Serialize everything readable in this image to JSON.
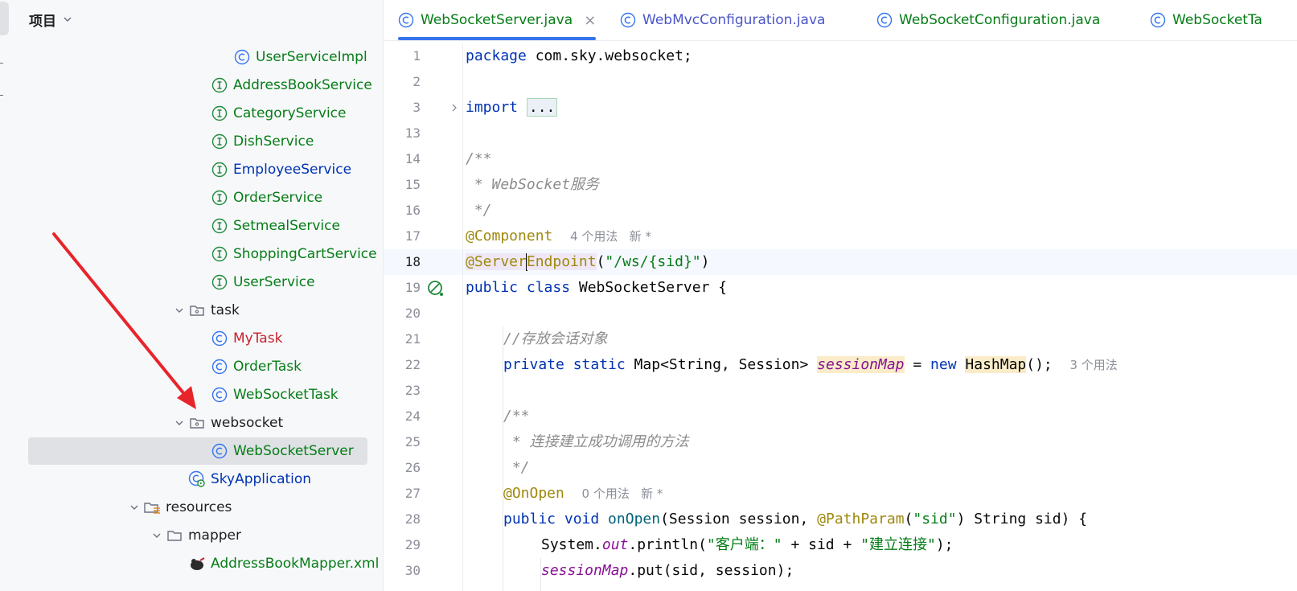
{
  "project_panel": {
    "title": "项目",
    "tree": [
      {
        "label": "UserServiceImpl",
        "kind": "class",
        "color": "#067d17"
      },
      {
        "label": "AddressBookService",
        "kind": "interface",
        "color": "#067d17"
      },
      {
        "label": "CategoryService",
        "kind": "interface",
        "color": "#067d17"
      },
      {
        "label": "DishService",
        "kind": "interface",
        "color": "#067d17"
      },
      {
        "label": "EmployeeService",
        "kind": "interface",
        "color": "#0033b3"
      },
      {
        "label": "OrderService",
        "kind": "interface",
        "color": "#067d17"
      },
      {
        "label": "SetmealService",
        "kind": "interface",
        "color": "#067d17"
      },
      {
        "label": "ShoppingCartService",
        "kind": "interface",
        "color": "#067d17"
      },
      {
        "label": "UserService",
        "kind": "interface",
        "color": "#067d17"
      },
      {
        "label": "task",
        "kind": "package",
        "color": "#1e1f22"
      },
      {
        "label": "MyTask",
        "kind": "class",
        "color": "#c7222d"
      },
      {
        "label": "OrderTask",
        "kind": "class",
        "color": "#067d17"
      },
      {
        "label": "WebSocketTask",
        "kind": "class",
        "color": "#067d17"
      },
      {
        "label": "websocket",
        "kind": "package",
        "color": "#1e1f22"
      },
      {
        "label": "WebSocketServer",
        "kind": "class",
        "color": "#067d17"
      },
      {
        "label": "SkyApplication",
        "kind": "app",
        "color": "#0033b3"
      },
      {
        "label": "resources",
        "kind": "resources",
        "color": "#1e1f22"
      },
      {
        "label": "mapper",
        "kind": "folder",
        "color": "#1e1f22"
      },
      {
        "label": "AddressBookMapper.xml",
        "kind": "xml",
        "color": "#067d17"
      }
    ]
  },
  "editor": {
    "tabs": [
      {
        "label": "WebSocketServer.java",
        "color": "#067d17",
        "close": "×"
      },
      {
        "label": "WebMvcConfiguration.java",
        "color": "#0033b3"
      },
      {
        "label": "WebSocketConfiguration.java",
        "color": "#067d17"
      },
      {
        "label": "WebSocketTa",
        "color": "#067d17"
      }
    ],
    "line_numbers": [
      "1",
      "2",
      "3",
      "13",
      "14",
      "15",
      "16",
      "17",
      "18",
      "19",
      "20",
      "21",
      "22",
      "23",
      "24",
      "25",
      "26",
      "27",
      "28",
      "29",
      "30"
    ],
    "current_line": "18",
    "code": {
      "l1_kw": "package",
      "l1_rest": " com.sky.websocket;",
      "l3_kw": "import",
      "l3_fold": "...",
      "l14": "/**",
      "l15": " * WebSocket服务",
      "l16": " */",
      "l17_ann": "@Component",
      "l17_hint": "4 个用法   新 *",
      "l18_ann_a": "@Server",
      "l18_ann_b": "Endpoint",
      "l18_p1": "(",
      "l18_str": "\"/ws/{sid}\"",
      "l18_p2": ")",
      "l19_kw": "public class",
      "l19_rest": " WebSocketServer {",
      "l21": "//存放会话对象",
      "l22_kw": "private static",
      "l22_a": " Map<String, Session> ",
      "l22_field": "sessionMap",
      "l22_b": " = ",
      "l22_new": "new",
      "l22_c": " ",
      "l22_hm": "HashMap",
      "l22_d": "();",
      "l22_hint": "3 个用法",
      "l24": "/**",
      "l25": " * 连接建立成功调用的方法",
      "l26": " */",
      "l27_ann": "@OnOpen",
      "l27_hint": "0 个用法   新 *",
      "l28_kw": "public void",
      "l28_fn": " onOpen",
      "l28_a": "(Session session, ",
      "l28_ann": "@PathParam",
      "l28_b": "(",
      "l28_str": "\"sid\"",
      "l28_c": ") String sid) {",
      "l29_a": "System.",
      "l29_out": "out",
      "l29_b": ".println(",
      "l29_s1": "\"客户端：\"",
      "l29_c": " + sid + ",
      "l29_s2": "\"建立连接\"",
      "l29_d": ");",
      "l30_field": "sessionMap",
      "l30_rest": ".put(sid, session);"
    }
  }
}
